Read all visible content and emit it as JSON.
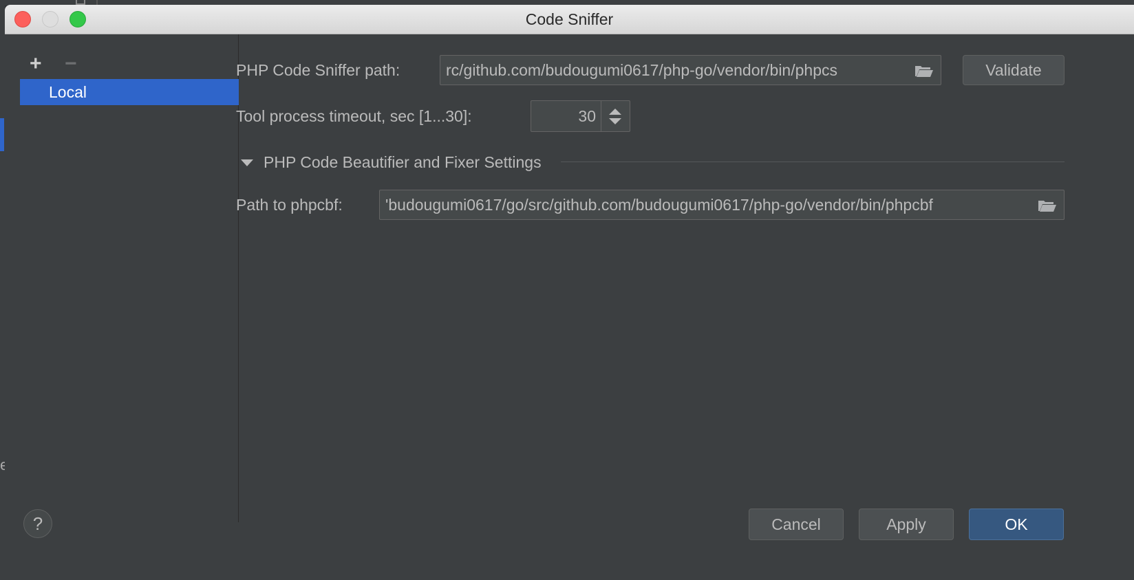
{
  "window": {
    "title": "Code Sniffer"
  },
  "sidebar": {
    "add_icon": "plus-icon",
    "remove_icon": "minus-icon",
    "items": [
      {
        "label": "Local",
        "selected": true
      }
    ]
  },
  "form": {
    "sniffer_path_label": "PHP Code Sniffer path:",
    "sniffer_path_value": "rc/github.com/budougumi0617/php-go/vendor/bin/phpcs",
    "validate_label": "Validate",
    "timeout_label": "Tool process timeout, sec [1...30]:",
    "timeout_value": "30",
    "section_title": "PHP Code Beautifier and Fixer Settings",
    "phpcbf_label": "Path to phpcbf:",
    "phpcbf_value": "'budougumi0617/go/src/github.com/budougumi0617/php-go/vendor/bin/phpcbf",
    "folder_icon": "folder-open-icon"
  },
  "footer": {
    "help_label": "?",
    "cancel_label": "Cancel",
    "apply_label": "Apply",
    "ok_label": "OK"
  },
  "colors": {
    "selection": "#2f65ca",
    "ok_button": "#365880",
    "background": "#3c3f41"
  }
}
